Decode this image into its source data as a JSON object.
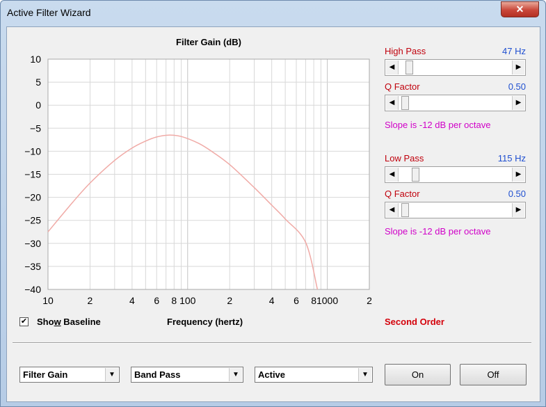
{
  "window": {
    "title": "Active Filter Wizard",
    "close_glyph": "✕"
  },
  "chart_data": {
    "type": "line",
    "title": "Filter Gain (dB)",
    "xlabel": "Frequency (hertz)",
    "ylabel": "",
    "x_scale": "log",
    "xlim": [
      10,
      2000
    ],
    "ylim": [
      -40,
      10
    ],
    "y_ticks": [
      "10",
      "5",
      "0",
      "-5",
      "-10",
      "-15",
      "-20",
      "-25",
      "-30",
      "-35",
      "-40"
    ],
    "x_ticks": [
      {
        "value": 10,
        "label": "10"
      },
      {
        "value": 20,
        "label": "2"
      },
      {
        "value": 40,
        "label": "4"
      },
      {
        "value": 60,
        "label": "6"
      },
      {
        "value": 80,
        "label": "8"
      },
      {
        "value": 100,
        "label": "100"
      },
      {
        "value": 200,
        "label": "2"
      },
      {
        "value": 400,
        "label": "4"
      },
      {
        "value": 600,
        "label": "6"
      },
      {
        "value": 800,
        "label": "8"
      },
      {
        "value": 1000,
        "label": "1000"
      },
      {
        "value": 2000,
        "label": "2"
      }
    ],
    "grid": true,
    "series": [
      {
        "color": "#f0aaa6",
        "x": [
          10,
          15,
          20,
          30,
          40,
          50,
          60,
          73,
          90,
          120,
          150,
          200,
          300,
          400,
          500,
          700,
          850
        ],
        "y": [
          -27.5,
          -21.1,
          -16.9,
          -12.0,
          -9.3,
          -7.8,
          -6.9,
          -6.5,
          -6.8,
          -8.3,
          -10.1,
          -12.9,
          -17.9,
          -21.7,
          -24.7,
          -29.8,
          -40.0
        ]
      }
    ]
  },
  "high_pass": {
    "label": "High Pass",
    "value": "47 Hz",
    "q_label": "Q Factor",
    "q_value": "0.50",
    "slope": "Slope is -12 dB per octave",
    "position": 0.06,
    "q_position": 0.02
  },
  "low_pass": {
    "label": "Low Pass",
    "value": "115 Hz",
    "q_label": "Q Factor",
    "q_value": "0.50",
    "slope": "Slope is -12 dB per octave",
    "position": 0.12,
    "q_position": 0.02
  },
  "scroll_arrows": {
    "left": "◀",
    "right": "▶"
  },
  "order_label": "Second Order",
  "baseline": {
    "checked": true,
    "check_glyph": "✔",
    "label_pre": "Sho",
    "label_ul": "w",
    "label_post": " Baseline"
  },
  "controls": {
    "combo1": "Filter Gain",
    "combo2": "Band Pass",
    "combo3": "Active",
    "combo_arrow": "▼",
    "on_label": "On",
    "off_label": "Off"
  }
}
